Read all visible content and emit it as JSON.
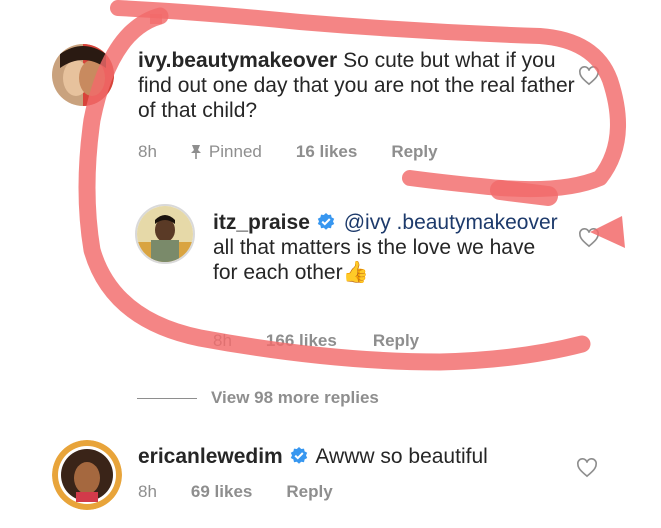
{
  "comments": [
    {
      "username": "ivy.beautymakeover",
      "text": "So cute but what if you find out  one day  that you are not the real father of that child?",
      "time": "8h",
      "pinned_label": "Pinned",
      "likes": "16 likes",
      "reply_label": "Reply"
    },
    {
      "username": "itz_praise",
      "mention": "@ivy .beautymakeover",
      "text": "all that matters is the love we have for each other",
      "emoji": "👍",
      "time": "8h",
      "likes": "166 likes",
      "reply_label": "Reply"
    },
    {
      "username": "ericanlewedim",
      "text": "Awww so beautiful",
      "time": "8h",
      "likes": "69 likes",
      "reply_label": "Reply"
    }
  ],
  "view_more_replies": "View 98 more replies",
  "icons": {
    "heart": "heart-outline-icon",
    "pin": "pin-icon",
    "verified": "verified-badge-icon"
  },
  "colors": {
    "scribble": "#f26a6a",
    "verified": "#3897f0",
    "meta": "#8e8e8e",
    "emoji": "#f5b500"
  }
}
